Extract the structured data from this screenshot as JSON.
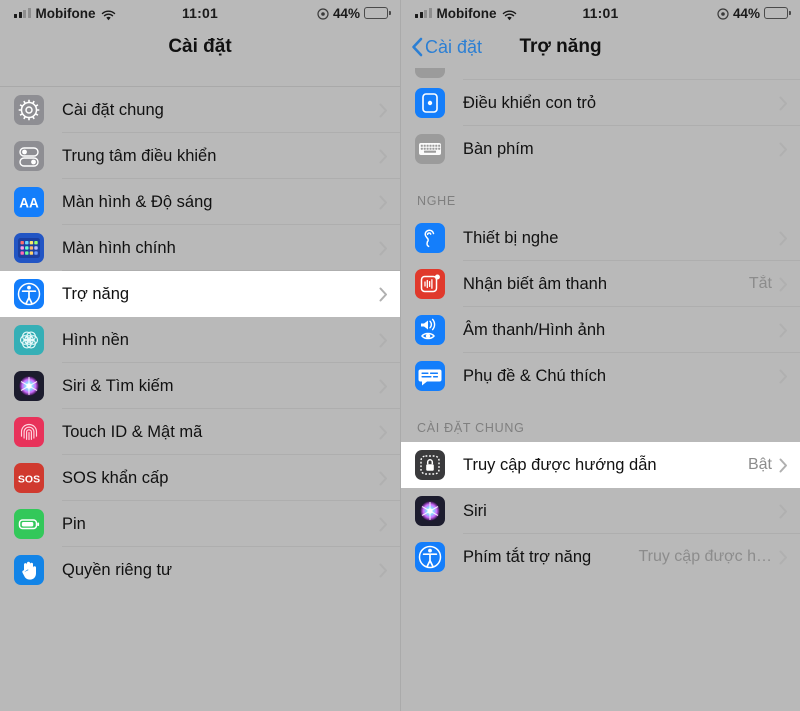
{
  "status_bar": {
    "carrier": "Mobifone",
    "time": "11:01",
    "battery_percent": "44%",
    "wifi_icon": "wifi-icon",
    "signal_icon": "signal-bars-icon",
    "location_icon": "location-services-icon",
    "battery_icon": "battery-icon"
  },
  "left_screen": {
    "nav": {
      "title": "Cài đặt"
    },
    "items": [
      {
        "label": "Cài đặt chung",
        "icon": "gear-icon",
        "icon_bg": "#8e8e93",
        "value": ""
      },
      {
        "label": "Trung tâm điều khiển",
        "icon": "toggles-icon",
        "icon_bg": "#8e8e93",
        "value": ""
      },
      {
        "label": "Màn hình & Độ sáng",
        "icon": "aa-text-icon",
        "icon_bg": "#147efb",
        "value": ""
      },
      {
        "label": "Màn hình chính",
        "icon": "home-screen-icon",
        "icon_bg": "#2255c4",
        "value": ""
      },
      {
        "label": "Trợ năng",
        "icon": "accessibility-icon",
        "icon_bg": "#147efb",
        "value": "",
        "highlighted": true
      },
      {
        "label": "Hình nền",
        "icon": "wallpaper-icon",
        "icon_bg": "#35afb6",
        "value": ""
      },
      {
        "label": "Siri & Tìm kiếm",
        "icon": "siri-icon",
        "icon_bg": "#1c1c2e",
        "value": ""
      },
      {
        "label": "Touch ID & Mật mã",
        "icon": "fingerprint-icon",
        "icon_bg": "#e8325a",
        "value": ""
      },
      {
        "label": "SOS khẩn cấp",
        "icon": "sos-icon",
        "icon_bg": "#d03a2f",
        "value": ""
      },
      {
        "label": "Pin",
        "icon": "battery-green-icon",
        "icon_bg": "#33c85a",
        "value": ""
      },
      {
        "label": "Quyền riêng tư",
        "icon": "hand-privacy-icon",
        "icon_bg": "#1284e7",
        "value": ""
      }
    ]
  },
  "right_screen": {
    "nav": {
      "back_label": "Cài đặt",
      "title": "Trợ năng",
      "back_icon": "chevron-left-icon"
    },
    "sections": [
      {
        "header": "",
        "items": [
          {
            "label": "Điều khiển con trỏ",
            "icon": "pointer-control-icon",
            "icon_bg": "#147efb",
            "value": ""
          },
          {
            "label": "Bàn phím",
            "icon": "keyboard-icon",
            "icon_bg": "#9b9b9b",
            "value": ""
          }
        ]
      },
      {
        "header": "NGHE",
        "items": [
          {
            "label": "Thiết bị nghe",
            "icon": "ear-hearing-icon",
            "icon_bg": "#147efb",
            "value": ""
          },
          {
            "label": "Nhận biết âm thanh",
            "icon": "sound-recognition-icon",
            "icon_bg": "#e0392c",
            "value": "Tắt"
          },
          {
            "label": "Âm thanh/Hình ảnh",
            "icon": "audio-visual-icon",
            "icon_bg": "#147efb",
            "value": ""
          },
          {
            "label": "Phụ đề & Chú thích",
            "icon": "captions-icon",
            "icon_bg": "#147efb",
            "value": ""
          }
        ]
      },
      {
        "header": "CÀI ĐẶT CHUNG",
        "items": [
          {
            "label": "Truy cập được hướng dẫn",
            "icon": "guided-access-lock-icon",
            "icon_bg": "#3a3a3c",
            "value": "Bật",
            "highlighted": true
          },
          {
            "label": "Siri",
            "icon": "siri-icon",
            "icon_bg": "#1c1c2e",
            "value": ""
          },
          {
            "label": "Phím tắt trợ năng",
            "icon": "accessibility-icon",
            "icon_bg": "#147efb",
            "value": "Truy cập được h…"
          }
        ]
      }
    ]
  },
  "colors": {
    "accent_blue": "#147efb",
    "page_bg": "#b9b9b9",
    "highlight_bg": "#ffffff"
  }
}
